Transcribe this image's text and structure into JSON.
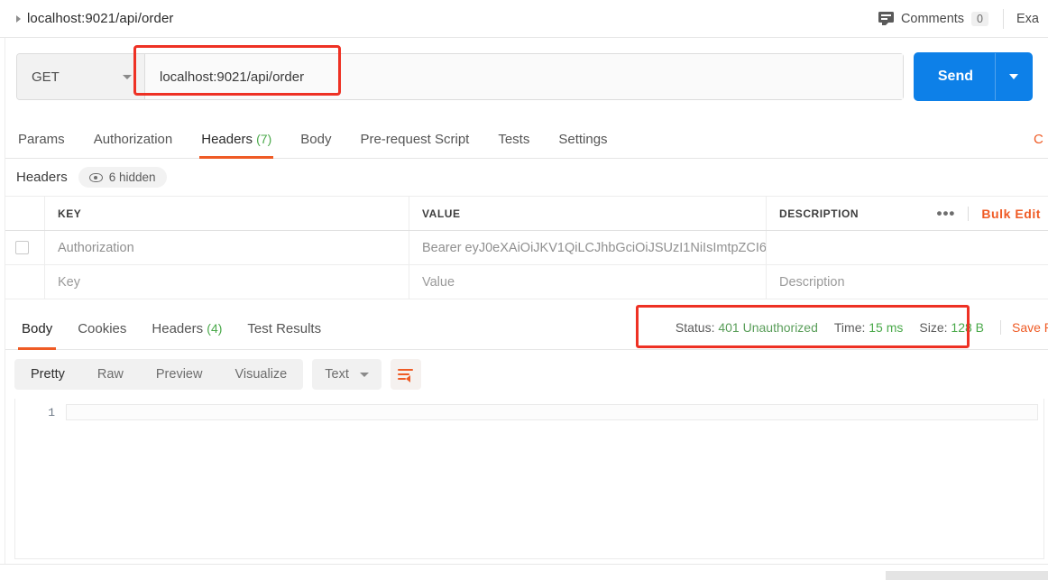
{
  "topbar": {
    "breadcrumb": "localhost:9021/api/order",
    "comments_label": "Comments",
    "comments_count": "0",
    "examples_label": "Exa"
  },
  "request": {
    "method": "GET",
    "url": "localhost:9021/api/order",
    "send_label": "Send",
    "tabs": [
      {
        "label": "Params",
        "count": "",
        "active": false
      },
      {
        "label": "Authorization",
        "count": "",
        "active": false
      },
      {
        "label": "Headers",
        "count": "(7)",
        "active": true
      },
      {
        "label": "Body",
        "count": "",
        "active": false
      },
      {
        "label": "Pre-request Script",
        "count": "",
        "active": false
      },
      {
        "label": "Tests",
        "count": "",
        "active": false
      },
      {
        "label": "Settings",
        "count": "",
        "active": false
      }
    ],
    "cookies_link": "C"
  },
  "headers_section": {
    "title": "Headers",
    "hidden_badge": "6 hidden",
    "columns": {
      "key": "KEY",
      "value": "VALUE",
      "description": "DESCRIPTION"
    },
    "bulk_edit": "Bulk Edit",
    "more_actions": "•••",
    "rows": [
      {
        "key": "Authorization",
        "value": "Bearer eyJ0eXAiOiJKV1QiLCJhbGciOiJSUzI1NiIsImtpZCI6",
        "description": "",
        "checked": false,
        "placeholder_row": false
      },
      {
        "key": "Key",
        "value": "Value",
        "description": "Description",
        "checked": false,
        "placeholder_row": true
      }
    ]
  },
  "response": {
    "tabs": [
      {
        "label": "Body",
        "count": "",
        "active": true
      },
      {
        "label": "Cookies",
        "count": "",
        "active": false
      },
      {
        "label": "Headers",
        "count": "(4)",
        "active": false
      },
      {
        "label": "Test Results",
        "count": "",
        "active": false
      }
    ],
    "status_label": "Status:",
    "status_value": "401 Unauthorized",
    "time_label": "Time:",
    "time_value": "15 ms",
    "size_label": "Size:",
    "size_value": "128 B",
    "save_response": "Save R",
    "viewer": {
      "modes": [
        {
          "label": "Pretty",
          "active": true
        },
        {
          "label": "Raw",
          "active": false
        },
        {
          "label": "Preview",
          "active": false
        },
        {
          "label": "Visualize",
          "active": false
        }
      ],
      "format": "Text",
      "wrap_icon": "word-wrap-icon"
    },
    "body_lines": [
      {
        "number": "1",
        "text": ""
      }
    ]
  },
  "colors": {
    "accent_orange": "#ef5b25",
    "send_blue": "#0d80e8",
    "status_green": "#4aa94a",
    "annotation_red": "#ee3124"
  }
}
